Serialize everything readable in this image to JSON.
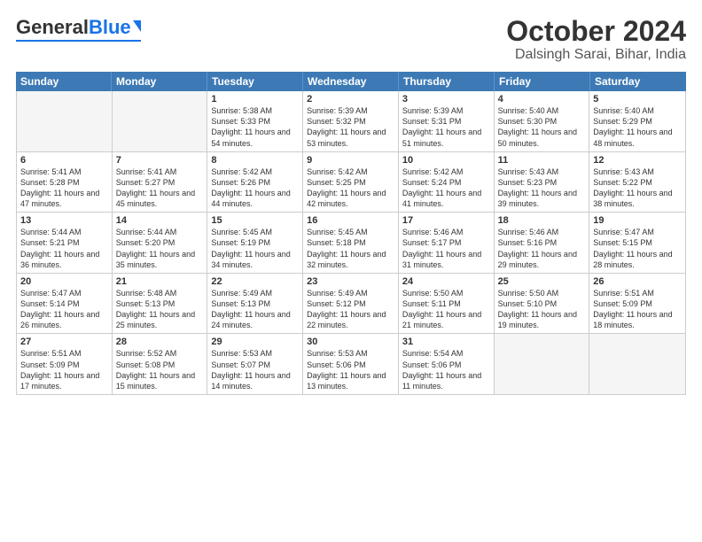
{
  "header": {
    "logo_general": "General",
    "logo_blue": "Blue",
    "month_title": "October 2024",
    "location": "Dalsingh Sarai, Bihar, India"
  },
  "days_of_week": [
    "Sunday",
    "Monday",
    "Tuesday",
    "Wednesday",
    "Thursday",
    "Friday",
    "Saturday"
  ],
  "weeks": [
    [
      {
        "day": "",
        "sunrise": "",
        "sunset": "",
        "daylight": "",
        "empty": true
      },
      {
        "day": "",
        "sunrise": "",
        "sunset": "",
        "daylight": "",
        "empty": true
      },
      {
        "day": "1",
        "sunrise": "Sunrise: 5:38 AM",
        "sunset": "Sunset: 5:33 PM",
        "daylight": "Daylight: 11 hours and 54 minutes.",
        "empty": false
      },
      {
        "day": "2",
        "sunrise": "Sunrise: 5:39 AM",
        "sunset": "Sunset: 5:32 PM",
        "daylight": "Daylight: 11 hours and 53 minutes.",
        "empty": false
      },
      {
        "day": "3",
        "sunrise": "Sunrise: 5:39 AM",
        "sunset": "Sunset: 5:31 PM",
        "daylight": "Daylight: 11 hours and 51 minutes.",
        "empty": false
      },
      {
        "day": "4",
        "sunrise": "Sunrise: 5:40 AM",
        "sunset": "Sunset: 5:30 PM",
        "daylight": "Daylight: 11 hours and 50 minutes.",
        "empty": false
      },
      {
        "day": "5",
        "sunrise": "Sunrise: 5:40 AM",
        "sunset": "Sunset: 5:29 PM",
        "daylight": "Daylight: 11 hours and 48 minutes.",
        "empty": false
      }
    ],
    [
      {
        "day": "6",
        "sunrise": "Sunrise: 5:41 AM",
        "sunset": "Sunset: 5:28 PM",
        "daylight": "Daylight: 11 hours and 47 minutes.",
        "empty": false
      },
      {
        "day": "7",
        "sunrise": "Sunrise: 5:41 AM",
        "sunset": "Sunset: 5:27 PM",
        "daylight": "Daylight: 11 hours and 45 minutes.",
        "empty": false
      },
      {
        "day": "8",
        "sunrise": "Sunrise: 5:42 AM",
        "sunset": "Sunset: 5:26 PM",
        "daylight": "Daylight: 11 hours and 44 minutes.",
        "empty": false
      },
      {
        "day": "9",
        "sunrise": "Sunrise: 5:42 AM",
        "sunset": "Sunset: 5:25 PM",
        "daylight": "Daylight: 11 hours and 42 minutes.",
        "empty": false
      },
      {
        "day": "10",
        "sunrise": "Sunrise: 5:42 AM",
        "sunset": "Sunset: 5:24 PM",
        "daylight": "Daylight: 11 hours and 41 minutes.",
        "empty": false
      },
      {
        "day": "11",
        "sunrise": "Sunrise: 5:43 AM",
        "sunset": "Sunset: 5:23 PM",
        "daylight": "Daylight: 11 hours and 39 minutes.",
        "empty": false
      },
      {
        "day": "12",
        "sunrise": "Sunrise: 5:43 AM",
        "sunset": "Sunset: 5:22 PM",
        "daylight": "Daylight: 11 hours and 38 minutes.",
        "empty": false
      }
    ],
    [
      {
        "day": "13",
        "sunrise": "Sunrise: 5:44 AM",
        "sunset": "Sunset: 5:21 PM",
        "daylight": "Daylight: 11 hours and 36 minutes.",
        "empty": false
      },
      {
        "day": "14",
        "sunrise": "Sunrise: 5:44 AM",
        "sunset": "Sunset: 5:20 PM",
        "daylight": "Daylight: 11 hours and 35 minutes.",
        "empty": false
      },
      {
        "day": "15",
        "sunrise": "Sunrise: 5:45 AM",
        "sunset": "Sunset: 5:19 PM",
        "daylight": "Daylight: 11 hours and 34 minutes.",
        "empty": false
      },
      {
        "day": "16",
        "sunrise": "Sunrise: 5:45 AM",
        "sunset": "Sunset: 5:18 PM",
        "daylight": "Daylight: 11 hours and 32 minutes.",
        "empty": false
      },
      {
        "day": "17",
        "sunrise": "Sunrise: 5:46 AM",
        "sunset": "Sunset: 5:17 PM",
        "daylight": "Daylight: 11 hours and 31 minutes.",
        "empty": false
      },
      {
        "day": "18",
        "sunrise": "Sunrise: 5:46 AM",
        "sunset": "Sunset: 5:16 PM",
        "daylight": "Daylight: 11 hours and 29 minutes.",
        "empty": false
      },
      {
        "day": "19",
        "sunrise": "Sunrise: 5:47 AM",
        "sunset": "Sunset: 5:15 PM",
        "daylight": "Daylight: 11 hours and 28 minutes.",
        "empty": false
      }
    ],
    [
      {
        "day": "20",
        "sunrise": "Sunrise: 5:47 AM",
        "sunset": "Sunset: 5:14 PM",
        "daylight": "Daylight: 11 hours and 26 minutes.",
        "empty": false
      },
      {
        "day": "21",
        "sunrise": "Sunrise: 5:48 AM",
        "sunset": "Sunset: 5:13 PM",
        "daylight": "Daylight: 11 hours and 25 minutes.",
        "empty": false
      },
      {
        "day": "22",
        "sunrise": "Sunrise: 5:49 AM",
        "sunset": "Sunset: 5:13 PM",
        "daylight": "Daylight: 11 hours and 24 minutes.",
        "empty": false
      },
      {
        "day": "23",
        "sunrise": "Sunrise: 5:49 AM",
        "sunset": "Sunset: 5:12 PM",
        "daylight": "Daylight: 11 hours and 22 minutes.",
        "empty": false
      },
      {
        "day": "24",
        "sunrise": "Sunrise: 5:50 AM",
        "sunset": "Sunset: 5:11 PM",
        "daylight": "Daylight: 11 hours and 21 minutes.",
        "empty": false
      },
      {
        "day": "25",
        "sunrise": "Sunrise: 5:50 AM",
        "sunset": "Sunset: 5:10 PM",
        "daylight": "Daylight: 11 hours and 19 minutes.",
        "empty": false
      },
      {
        "day": "26",
        "sunrise": "Sunrise: 5:51 AM",
        "sunset": "Sunset: 5:09 PM",
        "daylight": "Daylight: 11 hours and 18 minutes.",
        "empty": false
      }
    ],
    [
      {
        "day": "27",
        "sunrise": "Sunrise: 5:51 AM",
        "sunset": "Sunset: 5:09 PM",
        "daylight": "Daylight: 11 hours and 17 minutes.",
        "empty": false
      },
      {
        "day": "28",
        "sunrise": "Sunrise: 5:52 AM",
        "sunset": "Sunset: 5:08 PM",
        "daylight": "Daylight: 11 hours and 15 minutes.",
        "empty": false
      },
      {
        "day": "29",
        "sunrise": "Sunrise: 5:53 AM",
        "sunset": "Sunset: 5:07 PM",
        "daylight": "Daylight: 11 hours and 14 minutes.",
        "empty": false
      },
      {
        "day": "30",
        "sunrise": "Sunrise: 5:53 AM",
        "sunset": "Sunset: 5:06 PM",
        "daylight": "Daylight: 11 hours and 13 minutes.",
        "empty": false
      },
      {
        "day": "31",
        "sunrise": "Sunrise: 5:54 AM",
        "sunset": "Sunset: 5:06 PM",
        "daylight": "Daylight: 11 hours and 11 minutes.",
        "empty": false
      },
      {
        "day": "",
        "sunrise": "",
        "sunset": "",
        "daylight": "",
        "empty": true
      },
      {
        "day": "",
        "sunrise": "",
        "sunset": "",
        "daylight": "",
        "empty": true
      }
    ]
  ]
}
